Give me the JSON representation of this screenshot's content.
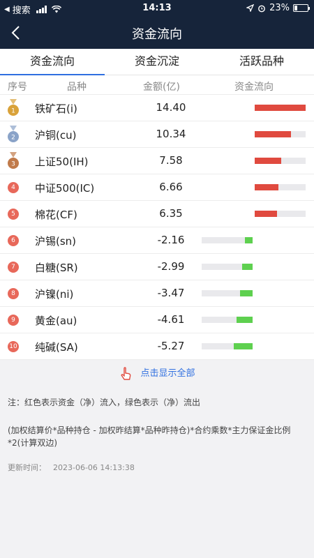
{
  "statusbar": {
    "carrier": "搜索",
    "time": "14:13",
    "battery": "23%"
  },
  "header": {
    "title": "资金流向"
  },
  "tabs": [
    {
      "label": "资金流向",
      "active": true
    },
    {
      "label": "资金沉淀",
      "active": false
    },
    {
      "label": "活跃品种",
      "active": false
    }
  ],
  "table": {
    "columns": [
      "序号",
      "品种",
      "金额(亿)",
      "资金流向"
    ],
    "rows": [
      {
        "rank": "1",
        "name": "铁矿石(i)",
        "amount": "14.40",
        "flow": 14.4
      },
      {
        "rank": "2",
        "name": "沪铜(cu)",
        "amount": "10.34",
        "flow": 10.34
      },
      {
        "rank": "3",
        "name": "上证50(IH)",
        "amount": "7.58",
        "flow": 7.58
      },
      {
        "rank": "4",
        "name": "中证500(IC)",
        "amount": "6.66",
        "flow": 6.66
      },
      {
        "rank": "5",
        "name": "棉花(CF)",
        "amount": "6.35",
        "flow": 6.35
      },
      {
        "rank": "6",
        "name": "沪锡(sn)",
        "amount": "-2.16",
        "flow": -2.16
      },
      {
        "rank": "7",
        "name": "白糖(SR)",
        "amount": "-2.99",
        "flow": -2.99
      },
      {
        "rank": "8",
        "name": "沪镍(ni)",
        "amount": "-3.47",
        "flow": -3.47
      },
      {
        "rank": "9",
        "name": "黄金(au)",
        "amount": "-4.61",
        "flow": -4.61
      },
      {
        "rank": "10",
        "name": "纯碱(SA)",
        "amount": "-5.27",
        "flow": -5.27
      }
    ]
  },
  "show_all": {
    "label": "点击显示全部"
  },
  "notes": {
    "legend": "注：红色表示资金（净）流入，绿色表示（净）流出",
    "formula": "(加权结算价*品种持仓 - 加权昨结算*品种昨持仓)*合约乘数*主力保证金比例*2(计算双边)"
  },
  "updated": {
    "label": "更新时间：",
    "value": "2023-06-06 14:13:38"
  },
  "colors": {
    "inflow": "#e04a3f",
    "outflow": "#5ed04f",
    "accent": "#2f6fe0",
    "navbar": "#16243a"
  }
}
